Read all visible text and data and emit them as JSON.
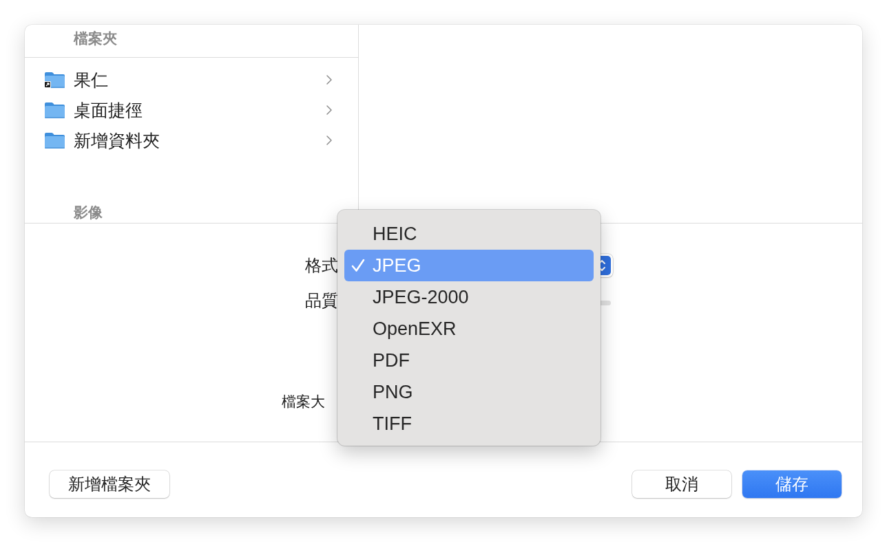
{
  "sidebar": {
    "section_header": "檔案夾",
    "items": [
      {
        "name": "果仁",
        "alias": true,
        "selected": false
      },
      {
        "name": "桌面捷徑",
        "alias": false,
        "selected": false
      },
      {
        "name": "新增資料夾",
        "alias": false,
        "selected": false
      }
    ],
    "footer_header": "影像"
  },
  "options": {
    "format_label": "格式",
    "quality_label": "品質",
    "file_size_label": "檔案大"
  },
  "format_menu": {
    "items": [
      {
        "label": "HEIC",
        "selected": false
      },
      {
        "label": "JPEG",
        "selected": true
      },
      {
        "label": "JPEG-2000",
        "selected": false
      },
      {
        "label": "OpenEXR",
        "selected": false
      },
      {
        "label": "PDF",
        "selected": false
      },
      {
        "label": "PNG",
        "selected": false
      },
      {
        "label": "TIFF",
        "selected": false
      }
    ]
  },
  "buttons": {
    "new_folder": "新增檔案夾",
    "cancel": "取消",
    "save": "儲存"
  }
}
